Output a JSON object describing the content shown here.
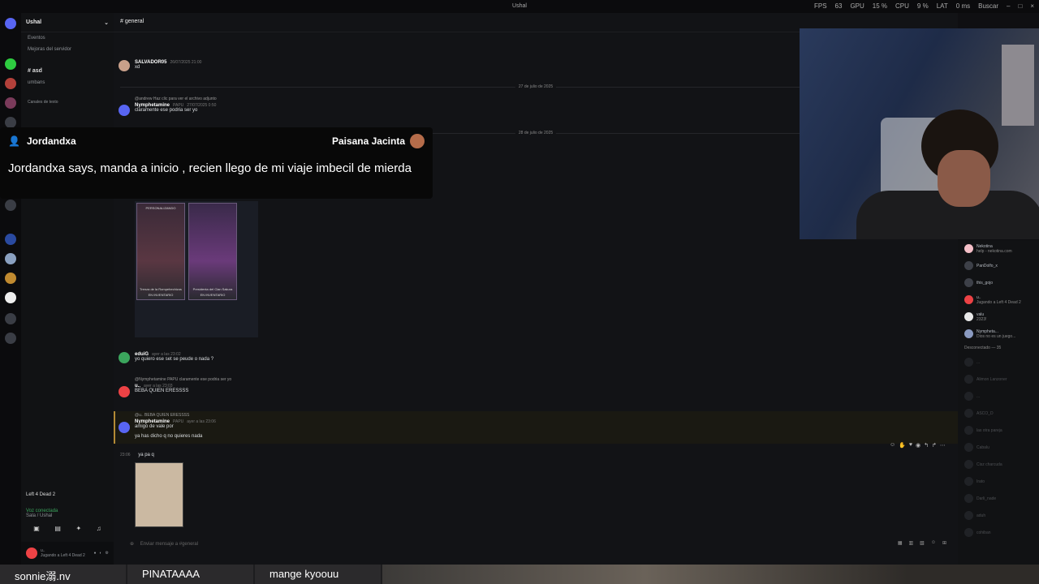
{
  "window": {
    "title": "Ushal"
  },
  "stats": {
    "fps_label": "FPS",
    "fps": "63",
    "gpu_label": "GPU",
    "gpu": "15 %",
    "cpu_label": "CPU",
    "cpu": "9 %",
    "lat_label": "LAT",
    "lat": "0 ms",
    "search": "Buscar"
  },
  "sidebar": {
    "server_name": "Ushal",
    "items": [
      "Eventos",
      "Mejoras del servidor"
    ],
    "channels": [
      "asd",
      "umbans"
    ],
    "category": "Canales de texto"
  },
  "voice": {
    "game": "Left 4 Dead 2",
    "status": "Voz conectada",
    "location": "Sala / Ushal"
  },
  "user_panel": {
    "name": "u..",
    "status": "Jugando a Left 4 Dead 2"
  },
  "chat": {
    "channel": "general",
    "messages": [
      {
        "author": "SALVADOR05",
        "time": "26/07/2025 21:00",
        "text": "xd"
      },
      {
        "reply": "@andrew Haz clic para ver el archivo adjunto",
        "author": "Nymphetamine",
        "badge": "PAPU",
        "time": "27/07/2025 0:50",
        "text": "claramente ese podria ser yo"
      },
      {
        "author": "eduiG",
        "time": "ayer a las 23:02",
        "text": "yo quiero ese set se peude o nada ?"
      },
      {
        "reply": "@Nymphetamine PAPU claramente ese podria ser yo",
        "author": "u..",
        "time": "ayer a las 23:03",
        "text": "BEBA QUIEN ERESSSS"
      },
      {
        "reply": "@u.. BEBA QUIEN ERESSSS",
        "author": "Nymphetamine",
        "badge": "PAPU",
        "time": "ayer a las 23:06",
        "text": "amigo de vale por",
        "text2": "ya has dicho q no quieres nada"
      },
      {
        "time": "23:06",
        "text": "ya pa q"
      }
    ],
    "dividers": [
      "27 de julio de 2025",
      "28 de julio de 2025"
    ],
    "cards": [
      {
        "tag": "PERSONALIZANDO",
        "caption": "Trenza de la Rompehechizos",
        "status": "EN INVENTARIO"
      },
      {
        "caption": "Presidenta del Clan Sakura",
        "status": "EN INVENTARIO"
      }
    ],
    "composer_placeholder": "Enviar mensaje a #general"
  },
  "members": {
    "online": [
      {
        "name": "Nekotina",
        "sub": "help - nekotina.com",
        "badge": "APP"
      },
      {
        "name": "PanDolfo_x"
      },
      {
        "name": "this_gojo"
      },
      {
        "name": "u..",
        "sub": "Jugando a Left 4 Dead 2"
      },
      {
        "name": "valu",
        "badge": "LADG",
        "sub": "2323!"
      },
      {
        "name": "Nymphetа...",
        "badge": "PAPU",
        "sub": "Dios no es un juego..."
      }
    ],
    "offline_label": "Desconectado — 35",
    "offline": [
      "...",
      "Alimon Lanzoner",
      "...",
      "ASCO_D",
      "las otra pareja",
      "Cabalu",
      "Cisz charcuda",
      "Irato",
      "Darli_nade",
      "aduh",
      "cohiban"
    ]
  },
  "overlay": {
    "speaker": "Jordandxa",
    "recipient": "Paisana Jacinta",
    "text": "Jordandxa says, manda a inicio , recien llego de mi viaje imbecil de mierda"
  },
  "stream_bar": [
    "sonnie溺.nv",
    "PINATAAAA",
    "mange kyoouu"
  ]
}
